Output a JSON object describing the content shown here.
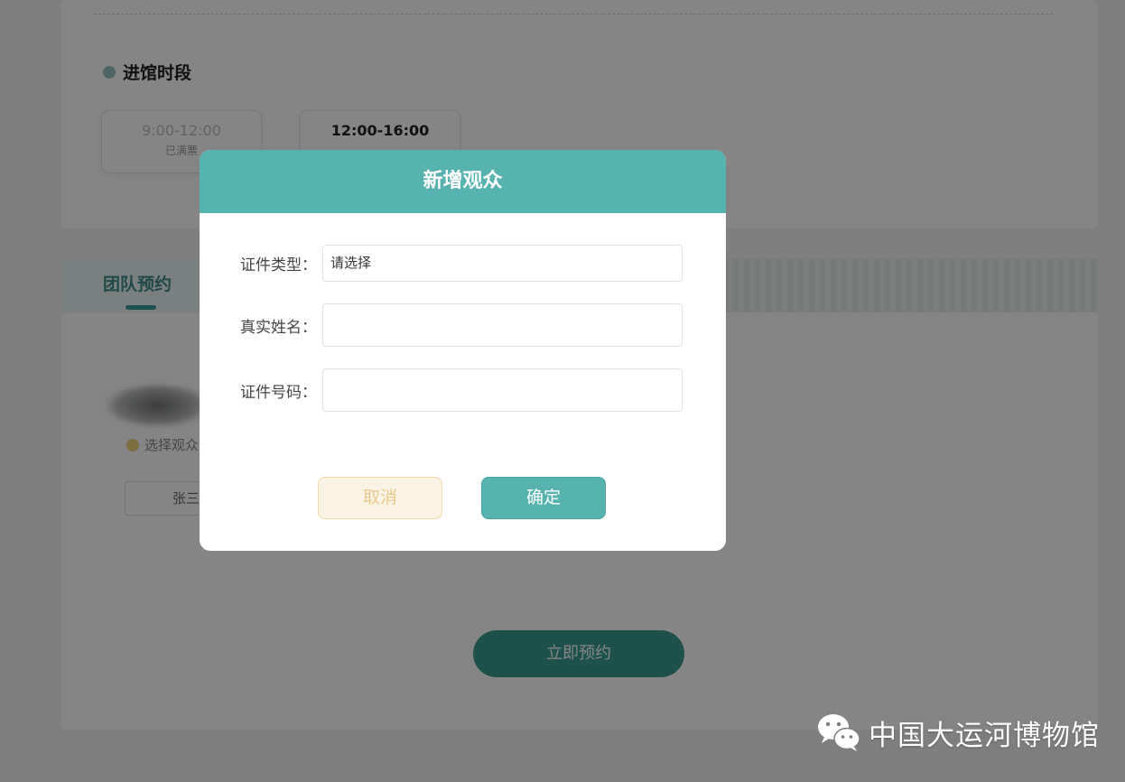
{
  "visit_time": {
    "title": "进馆时段",
    "slots": [
      {
        "time": "9:00-12:00",
        "status": "已满票"
      },
      {
        "time": "12:00-16:00"
      }
    ]
  },
  "tabs": {
    "active_label": "团队预约"
  },
  "visitors": {
    "select_label": "选择观众",
    "chip_name": "张三"
  },
  "book_button_label": "立即预约",
  "modal": {
    "title": "新增观众",
    "fields": [
      {
        "label": "证件类型：",
        "value": "请选择"
      },
      {
        "label": "真实姓名：",
        "value": ""
      },
      {
        "label": "证件号码：",
        "value": ""
      }
    ],
    "cancel_label": "取消",
    "confirm_label": "确定"
  },
  "watermark": {
    "text": "中国大运河博物馆",
    "icon": "wechat-icon"
  },
  "colors": {
    "accent": "#57b3af",
    "cancel_bg": "#fbf3e3",
    "overlay": "rgba(0,0,0,0.48)"
  }
}
